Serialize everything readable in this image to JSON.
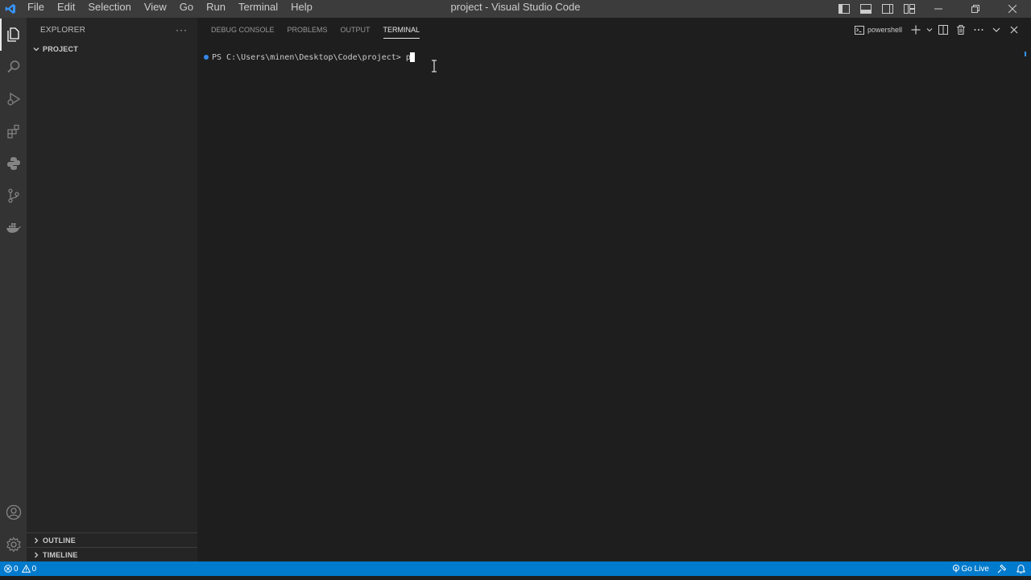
{
  "titlebar": {
    "menu": [
      "File",
      "Edit",
      "Selection",
      "View",
      "Go",
      "Run",
      "Terminal",
      "Help"
    ],
    "window_title": "project - Visual Studio Code"
  },
  "activitybar": {
    "icons": [
      "explorer-icon",
      "search-icon",
      "run-debug-icon",
      "extensions-icon",
      "python-icon",
      "source-control-icon",
      "docker-icon",
      "account-icon",
      "gear-icon"
    ]
  },
  "sidebar": {
    "title": "EXPLORER",
    "more": "···",
    "project_section": "PROJECT",
    "outline_section": "OUTLINE",
    "timeline_section": "TIMELINE"
  },
  "panel": {
    "tabs": [
      {
        "label": "DEBUG CONSOLE",
        "active": false
      },
      {
        "label": "PROBLEMS",
        "active": false
      },
      {
        "label": "OUTPUT",
        "active": false
      },
      {
        "label": "TERMINAL",
        "active": true
      }
    ],
    "terminal_name": "powershell",
    "prompt": "PS C:\\Users\\minen\\Desktop\\Code\\project> ",
    "input": "p"
  },
  "statusbar": {
    "errors": "0",
    "warnings": "0",
    "go_live": "Go Live"
  },
  "colors": {
    "accent": "#007acc",
    "titlebar": "#3c3c3c",
    "activitybar": "#333333",
    "sidebar": "#252526",
    "editor": "#1e1e1e"
  }
}
